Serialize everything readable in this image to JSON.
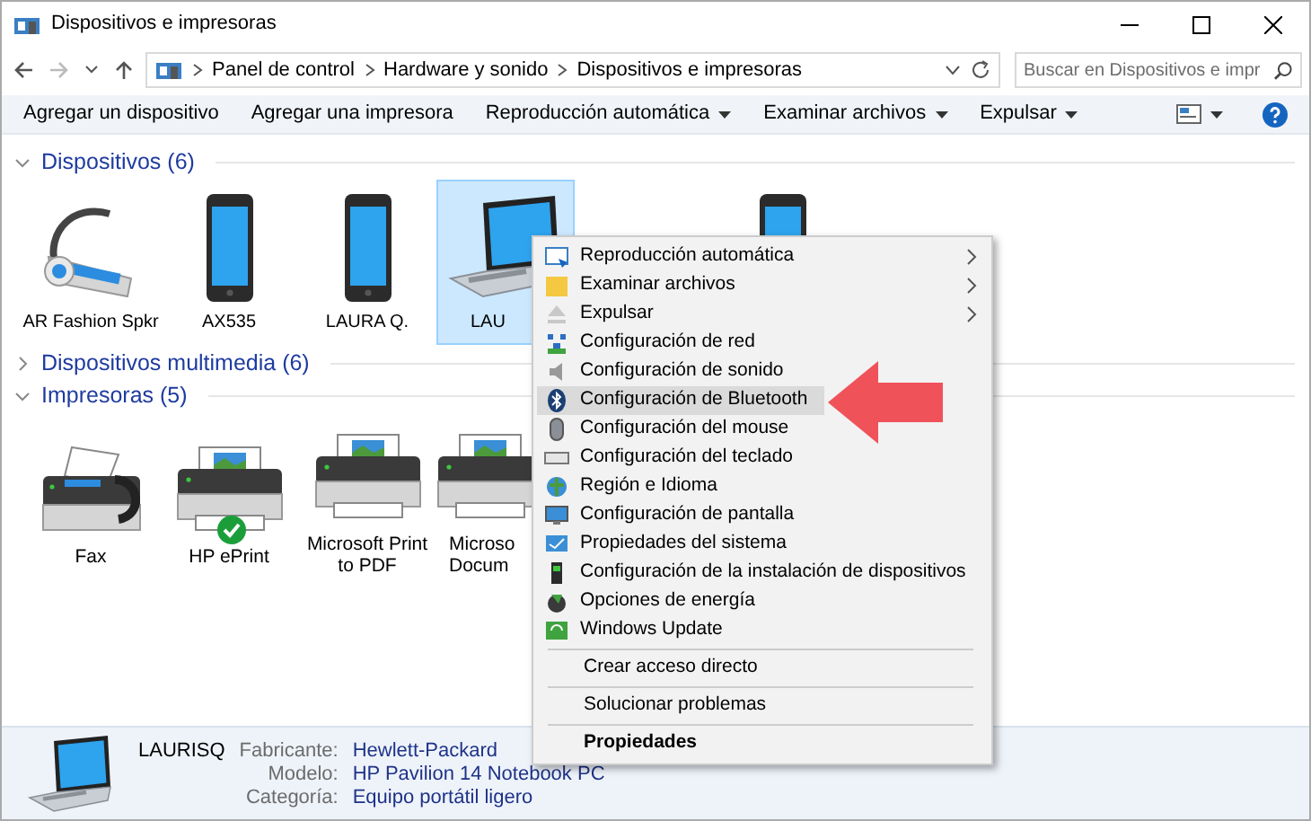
{
  "window": {
    "title": "Dispositivos e impresoras"
  },
  "address_bar": {
    "breadcrumbs": [
      "Panel de control",
      "Hardware y sonido",
      "Dispositivos e impresoras"
    ],
    "search_placeholder": "Buscar en Dispositivos e impr"
  },
  "command_bar": [
    {
      "label": "Agregar un dispositivo",
      "dropdown": false
    },
    {
      "label": "Agregar una impresora",
      "dropdown": false
    },
    {
      "label": "Reproducción automática",
      "dropdown": true
    },
    {
      "label": "Examinar archivos",
      "dropdown": true
    },
    {
      "label": "Expulsar",
      "dropdown": true
    }
  ],
  "sections": [
    {
      "title": "Dispositivos (6)",
      "expanded": true,
      "items": [
        {
          "kind": "headset",
          "label": "AR Fashion Spkr",
          "selected": false
        },
        {
          "kind": "phone",
          "label": "AX535",
          "selected": false
        },
        {
          "kind": "phone",
          "label": "LAURA Q.",
          "selected": false
        },
        {
          "kind": "laptop",
          "label": "LAU",
          "selected": true
        },
        {
          "kind": "blank"
        },
        {
          "kind": "phone",
          "selected": false
        }
      ]
    },
    {
      "title": "Dispositivos multimedia (6)",
      "expanded": false
    },
    {
      "title": "Impresoras (5)",
      "expanded": true,
      "items": [
        {
          "kind": "fax",
          "label": "Fax",
          "selected": false,
          "default": false
        },
        {
          "kind": "printer",
          "label": "HP ePrint",
          "selected": false,
          "default": true
        },
        {
          "kind": "printer",
          "label": "Microsoft Print to PDF",
          "selected": false,
          "default": false
        },
        {
          "kind": "printer",
          "label": "Microso\nDocum",
          "selected": false,
          "default": false
        }
      ]
    }
  ],
  "context_menu": [
    {
      "kind": "item",
      "label": "Reproducción automática",
      "submenu": true,
      "highlighted": false
    },
    {
      "kind": "item",
      "label": "Examinar archivos",
      "submenu": true,
      "highlighted": false
    },
    {
      "kind": "item",
      "label": "Expulsar",
      "submenu": true,
      "highlighted": false
    },
    {
      "kind": "item",
      "label": "Configuración de red",
      "submenu": false,
      "highlighted": false
    },
    {
      "kind": "item",
      "label": "Configuración de sonido",
      "submenu": false,
      "highlighted": false
    },
    {
      "kind": "item",
      "label": "Configuración de Bluetooth",
      "submenu": false,
      "highlighted": true
    },
    {
      "kind": "item",
      "label": "Configuración del mouse",
      "submenu": false,
      "highlighted": false
    },
    {
      "kind": "item",
      "label": "Configuración del teclado",
      "submenu": false,
      "highlighted": false
    },
    {
      "kind": "item",
      "label": "Región e Idioma",
      "submenu": false,
      "highlighted": false
    },
    {
      "kind": "item",
      "label": "Configuración de pantalla",
      "submenu": false,
      "highlighted": false
    },
    {
      "kind": "item",
      "label": "Propiedades del sistema",
      "submenu": false,
      "highlighted": false
    },
    {
      "kind": "item",
      "label": "Configuración de la instalación de dispositivos",
      "submenu": false,
      "highlighted": false
    },
    {
      "kind": "item",
      "label": "Opciones de energía",
      "submenu": false,
      "highlighted": false
    },
    {
      "kind": "item",
      "label": "Windows Update",
      "submenu": false,
      "highlighted": false
    },
    {
      "kind": "separator"
    },
    {
      "kind": "plain",
      "label": "Crear acceso directo",
      "submenu": false,
      "highlighted": false
    },
    {
      "kind": "separator"
    },
    {
      "kind": "plain",
      "label": "Solucionar problemas",
      "submenu": false,
      "highlighted": false
    },
    {
      "kind": "separator"
    },
    {
      "kind": "bold",
      "label": "Propiedades",
      "submenu": false,
      "highlighted": false
    }
  ],
  "details": {
    "name": "LAURISQ",
    "fields": [
      {
        "label": "Fabricante:",
        "value": "Hewlett-Packard"
      },
      {
        "label": "Modelo:",
        "value": "HP Pavilion 14 Notebook PC"
      },
      {
        "label": "Categoría:",
        "value": "Equipo portátil ligero"
      }
    ]
  }
}
